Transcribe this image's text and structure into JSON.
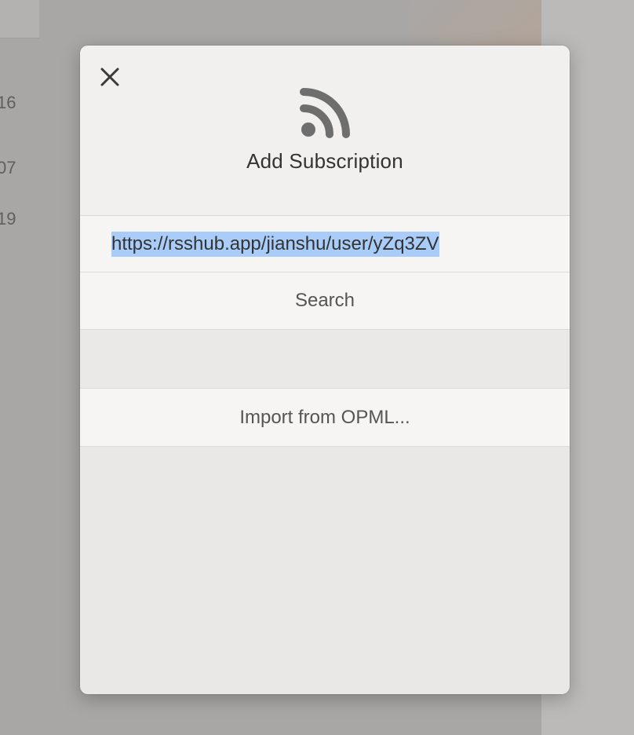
{
  "background": {
    "numbers": [
      "16",
      "07",
      "19"
    ]
  },
  "dialog": {
    "close_icon": "close-icon",
    "header_icon": "rss-feed-icon",
    "title": "Add Subscription",
    "url_input": {
      "value": "https://rsshub.app/jianshu/user/yZq3ZV"
    },
    "search_label": "Search",
    "import_label": "Import from OPML..."
  },
  "colors": {
    "selection_highlight": "#a9cdf8",
    "icon_gray": "#6e6e6e",
    "title_text": "#333333",
    "secondary_text": "#555555"
  }
}
